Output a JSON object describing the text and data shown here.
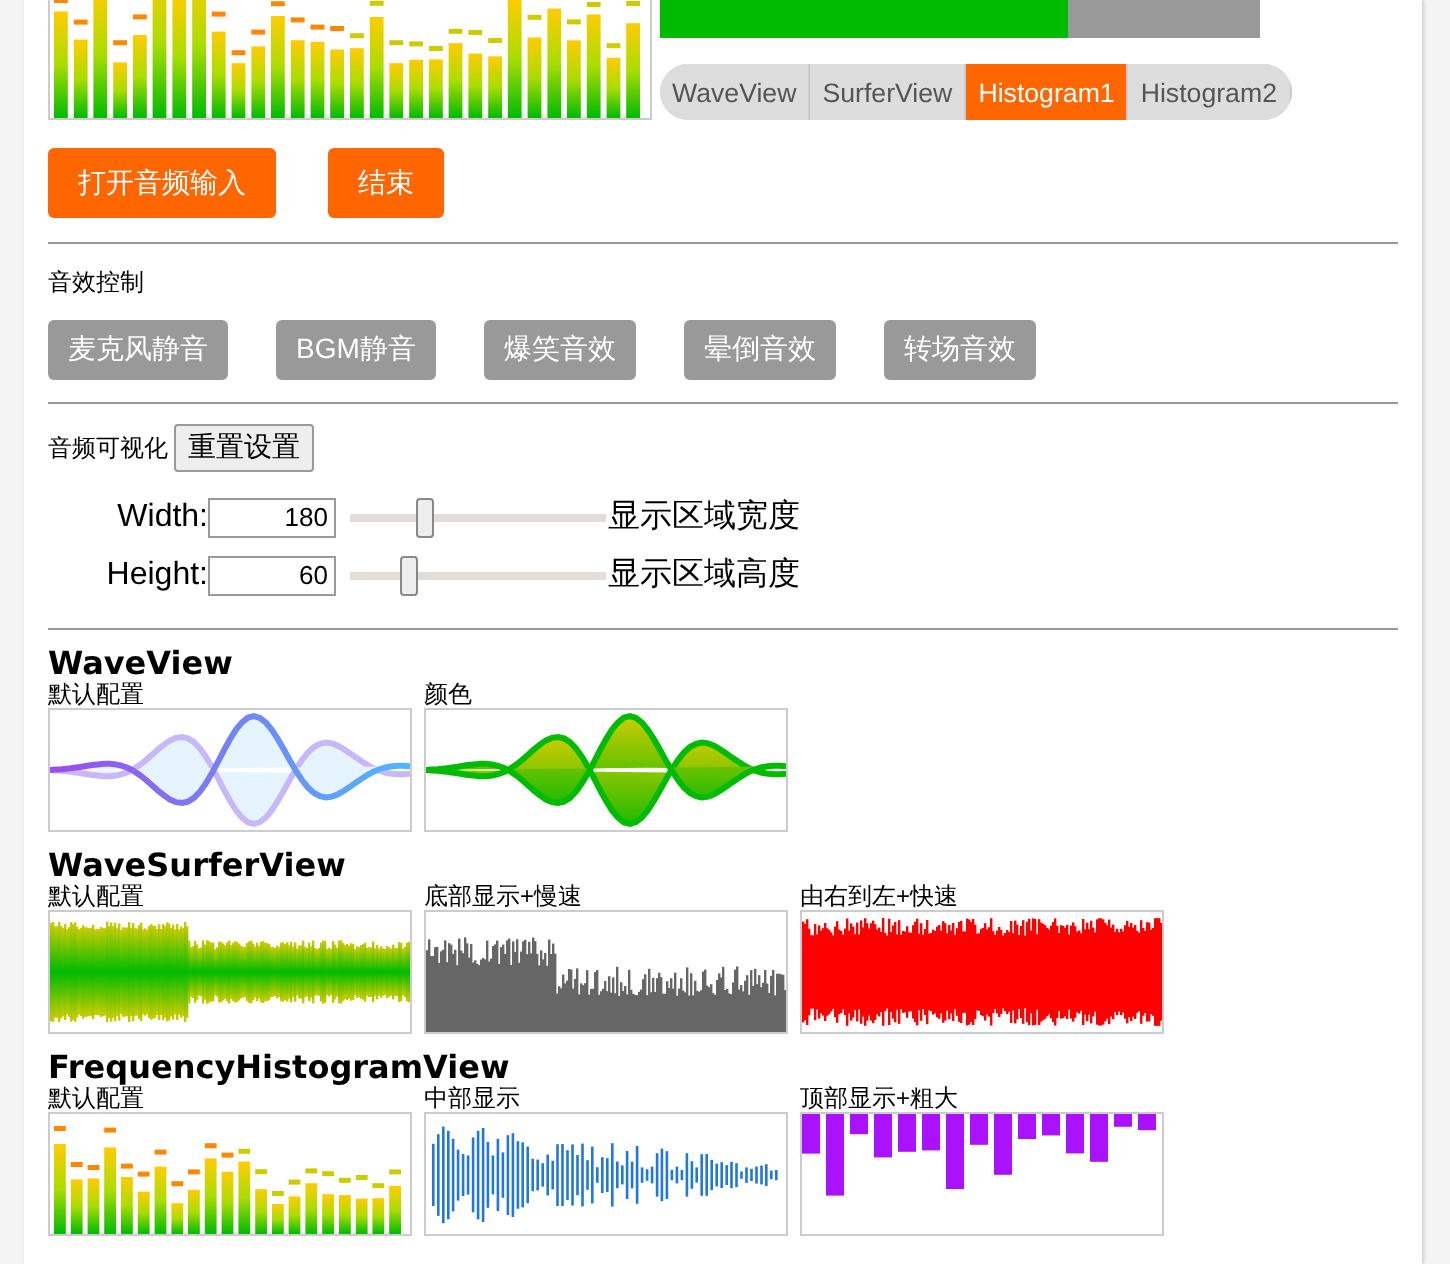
{
  "player": {
    "progress": {
      "level": 0.68
    },
    "tabs": [
      {
        "label": "WaveView",
        "selected": false
      },
      {
        "label": "SurferView",
        "selected": false
      },
      {
        "label": "Histogram1",
        "selected": true
      },
      {
        "label": "Histogram2",
        "selected": false
      }
    ]
  },
  "actions": [
    "打开音频输入",
    "结束"
  ],
  "effects": {
    "title": "音效控制",
    "buttons": [
      "麦克风静音",
      "BGM静音",
      "爆笑音效",
      "晕倒音效",
      "转场音效"
    ]
  },
  "visual": {
    "title": "音频可视化",
    "reset": "重置设置",
    "settings": [
      {
        "label": "Width:",
        "value": "180",
        "level": 0.29,
        "hint": "显示区域宽度"
      },
      {
        "label": "Height:",
        "value": "60",
        "level": 0.23,
        "hint": "显示区域高度"
      }
    ]
  },
  "views": [
    {
      "title": "WaveView",
      "kind": "wave",
      "items": [
        "默认配置",
        "颜色"
      ]
    },
    {
      "title": "WaveSurferView",
      "kind": "surfer",
      "items": [
        "默认配置",
        "底部显示+慢速",
        "由右到左+快速"
      ]
    },
    {
      "title": "FrequencyHistogramView",
      "kind": "histogram",
      "items": [
        "默认配置",
        "中部显示",
        "顶部显示+粗大"
      ]
    }
  ]
}
